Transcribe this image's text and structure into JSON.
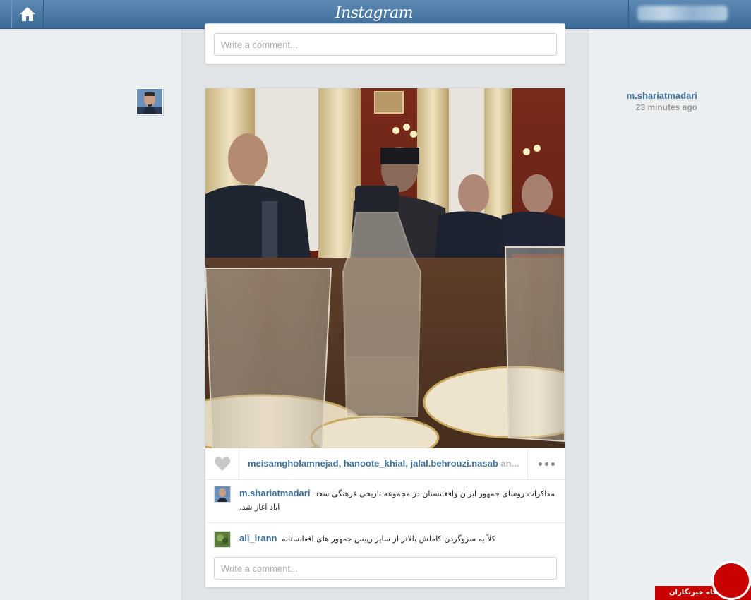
{
  "header": {
    "logo_text": "Instagram",
    "home_icon": "home-icon"
  },
  "previous_post": {
    "comment_placeholder": "Write a comment..."
  },
  "post": {
    "author": {
      "username": "m.shariatmadari",
      "timestamp": "23 minutes ago"
    },
    "likes": {
      "likers": [
        "meisamgholamnejad",
        "hanoote_khial",
        "jalal.behrouzi.nasab"
      ],
      "overflow_text": "an...",
      "separator": ", "
    },
    "comments": [
      {
        "username": "m.shariatmadari",
        "text": "مذاکرات روسای جمهور ایران وافغانستان در مجموعه تاریخی فرهنگی سعد آباد آغاز شد."
      },
      {
        "username": "ali_irann",
        "text": "کلاً یه سروگردن کاملش بالاتر از سایر رییس جمهور های افغانستانه"
      }
    ],
    "comment_placeholder": "Write a comment..."
  },
  "watermark": {
    "text": "باشگاه خبرنگاران"
  },
  "colors": {
    "header_blue": "#3c6a98",
    "username_blue": "#3f729b",
    "watermark_red": "#c90000"
  }
}
